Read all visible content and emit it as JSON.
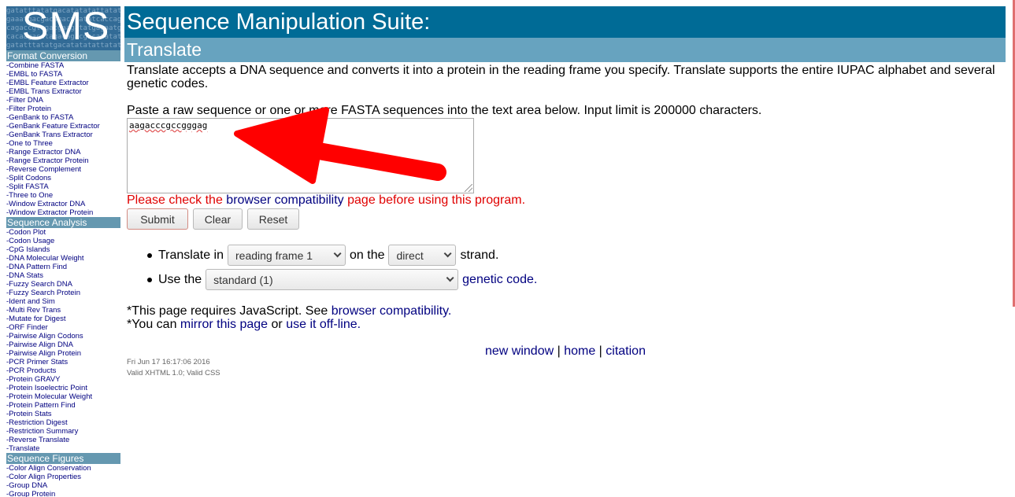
{
  "logo": {
    "text": "SMS",
    "bg_lines": [
      "gatatttatatgacatatatattatatat",
      "gaaatgacgacagacatatatcaccagg",
      "cagaccgtagacgaagatatgagaatgg",
      "cacaagacatagacagacgacatatata"
    ]
  },
  "sidebar": {
    "sections": [
      {
        "title": "Format Conversion",
        "items": [
          "-Combine FASTA",
          "-EMBL to FASTA",
          "-EMBL Feature Extractor",
          "-EMBL Trans Extractor",
          "-Filter DNA",
          "-Filter Protein",
          "-GenBank to FASTA",
          "-GenBank Feature Extractor",
          "-GenBank Trans Extractor",
          "-One to Three",
          "-Range Extractor DNA",
          "-Range Extractor Protein",
          "-Reverse Complement",
          "-Split Codons",
          "-Split FASTA",
          "-Three to One",
          "-Window Extractor DNA",
          "-Window Extractor Protein"
        ]
      },
      {
        "title": "Sequence Analysis",
        "items": [
          "-Codon Plot",
          "-Codon Usage",
          "-CpG Islands",
          "-DNA Molecular Weight",
          "-DNA Pattern Find",
          "-DNA Stats",
          "-Fuzzy Search DNA",
          "-Fuzzy Search Protein",
          "-Ident and Sim",
          "-Multi Rev Trans",
          "-Mutate for Digest",
          "-ORF Finder",
          "-Pairwise Align Codons",
          "-Pairwise Align DNA",
          "-Pairwise Align Protein",
          "-PCR Primer Stats",
          "-PCR Products",
          "-Protein GRAVY",
          "-Protein Isoelectric Point",
          "-Protein Molecular Weight",
          "-Protein Pattern Find",
          "-Protein Stats",
          "-Restriction Digest",
          "-Restriction Summary",
          "-Reverse Translate",
          "-Translate"
        ]
      },
      {
        "title": "Sequence Figures",
        "items": [
          "-Color Align Conservation",
          "-Color Align Properties",
          "-Group DNA",
          "-Group Protein"
        ]
      }
    ]
  },
  "header": {
    "title": "Sequence Manipulation Suite:",
    "subtitle": "Translate"
  },
  "main": {
    "description": "Translate accepts a DNA sequence and converts it into a protein in the reading frame you specify. Translate supports the entire IUPAC alphabet and several genetic codes.",
    "instructions": "Paste a raw sequence or one or more FASTA sequences into the text area below. Input limit is 200000 characters.",
    "sequence_value": "aagacccgccgggag",
    "notice": {
      "before": "Please check the ",
      "link": "browser compatibility",
      "after": " page before using this program."
    },
    "buttons": {
      "submit": "Submit",
      "clear": "Clear",
      "reset": "Reset"
    },
    "options": {
      "row1": {
        "prefix": "Translate in",
        "frame_selected": "reading frame 1",
        "middle": "on the",
        "strand_selected": "direct",
        "suffix": "strand."
      },
      "row2": {
        "prefix": "Use the",
        "code_selected": "standard (1)",
        "link": "genetic code."
      }
    },
    "notes": {
      "js_prefix": "*This page requires JavaScript. See ",
      "js_link": "browser compatibility.",
      "mirror_prefix": "*You can ",
      "mirror_link": "mirror this page",
      "mirror_middle": " or ",
      "offline_link": "use it off-line."
    },
    "footer_links": {
      "new_window": "new window",
      "sep": " | ",
      "home": "home",
      "citation": "citation"
    },
    "timestamp": "Fri Jun 17 16:17:06 2016",
    "validity": "Valid XHTML 1.0; Valid CSS"
  },
  "colors": {
    "header_dark": "#006b96",
    "header_light": "#67a3bf",
    "link": "#000080",
    "notice": "#e00000",
    "annotation_arrow": "#ff0000"
  }
}
